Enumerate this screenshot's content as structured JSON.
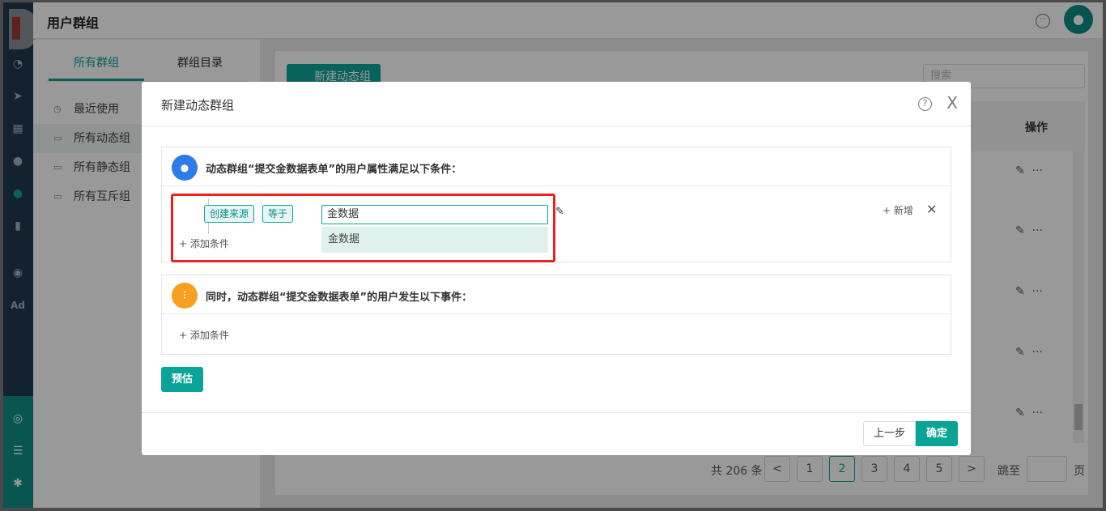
{
  "app": {
    "page_title": "用户群组",
    "accent_color": "#0aa496",
    "nav_icons": [
      "dashboard-icon",
      "send-icon",
      "layout-icon",
      "user-icon",
      "user-group-icon",
      "bar-chart-icon",
      "wechat-icon",
      "ad-icon",
      "people-circle-icon",
      "server-icon",
      "gear-icon"
    ],
    "ad_label": "Ad"
  },
  "left_panel": {
    "tabs": [
      {
        "label": "所有群组"
      },
      {
        "label": "群组目录"
      }
    ],
    "items": [
      {
        "label": "最近使用"
      },
      {
        "label": "所有动态组"
      },
      {
        "label": "所有静态组"
      },
      {
        "label": "所有互斥组"
      }
    ]
  },
  "main": {
    "new_button": "新建动态组",
    "search_placeholder": "搜索",
    "col_ops": "操作",
    "row_more": "···",
    "pager": {
      "total_text": "共 206 条",
      "prev": "<",
      "pages": [
        "1",
        "2",
        "3",
        "4",
        "5"
      ],
      "current": "2",
      "next": ">",
      "jump_label": "跳至",
      "page_suffix": "页"
    }
  },
  "modal": {
    "title": "新建动态群组",
    "close": "X",
    "help": "?",
    "attr_section": {
      "title": "动态群组“提交金数据表单”的用户属性满足以下条件：",
      "condition": {
        "field_tag": "创建来源",
        "op_tag": "等于",
        "value": "金数据",
        "dropdown_option": "金数据"
      },
      "add_condition": "添加条件",
      "add_new": "新增",
      "remove": "✕"
    },
    "event_section": {
      "title": "同时，动态群组“提交金数据表单”的用户发生以下事件：",
      "add_condition": "添加条件"
    },
    "estimate_button": "预估",
    "prev_button": "上一步",
    "ok_button": "确定"
  }
}
